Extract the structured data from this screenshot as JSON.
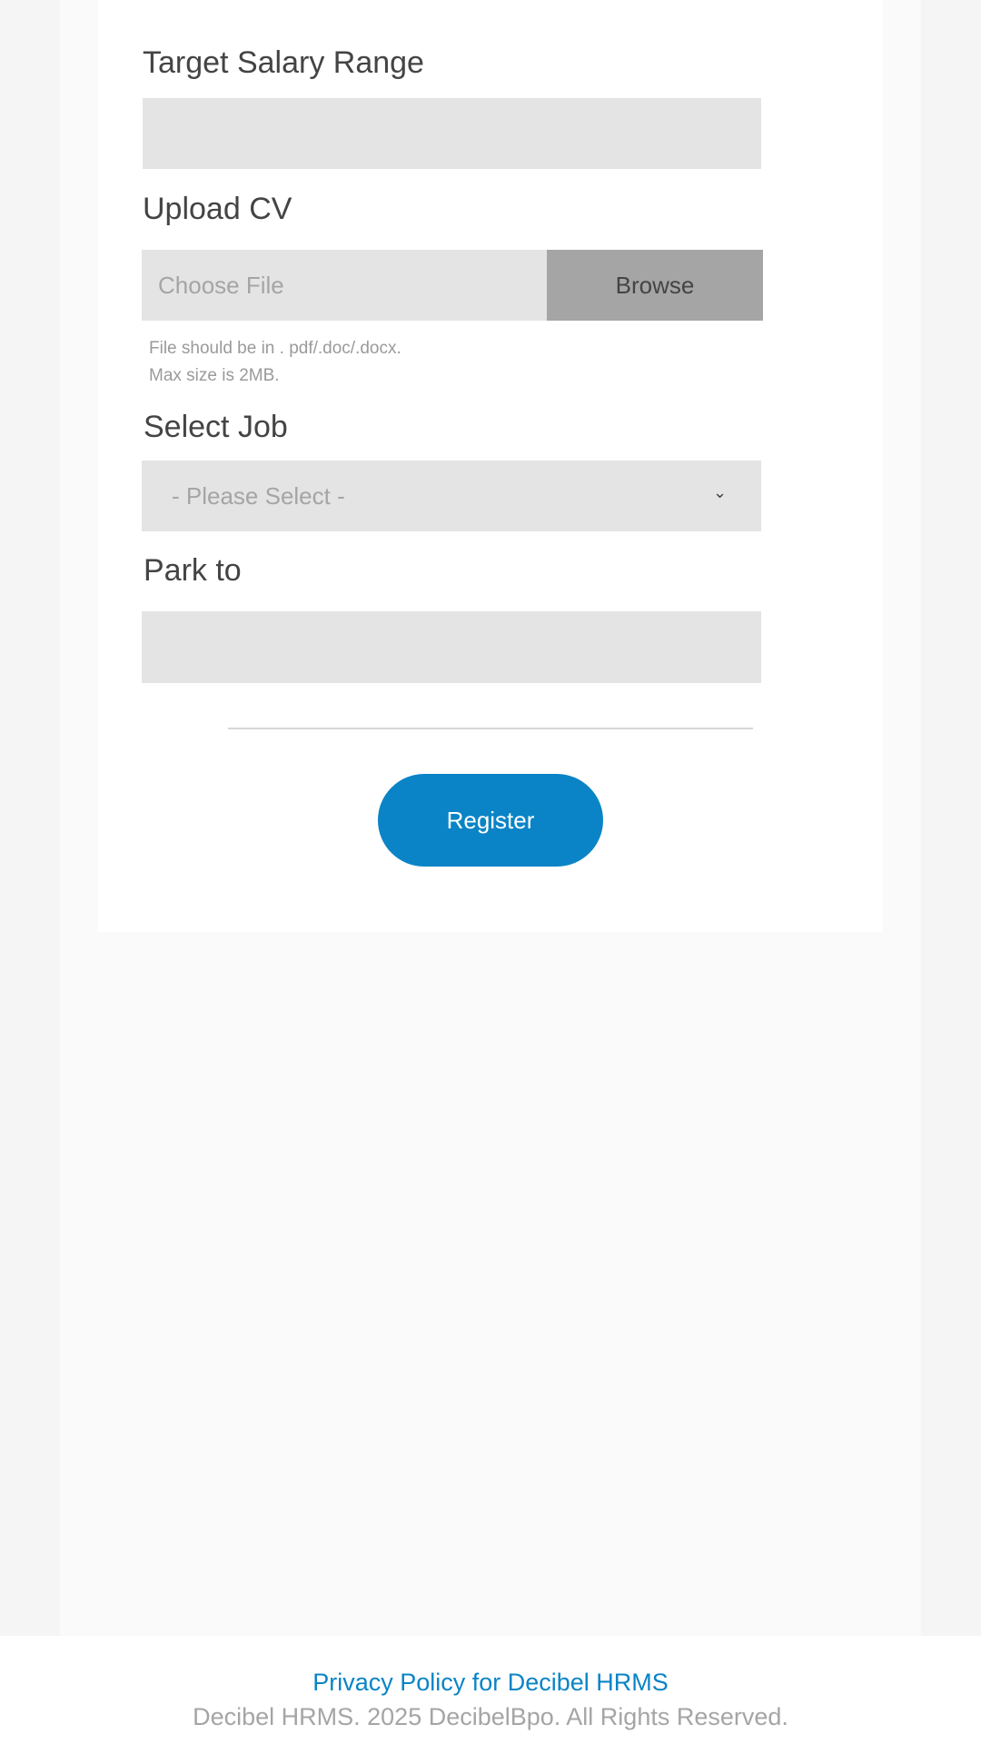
{
  "form": {
    "salary_label": "Target Salary Range",
    "salary_value": "",
    "cv_label": "Upload CV",
    "cv_placeholder": "Choose File",
    "browse_label": "Browse",
    "cv_hint_1": "File should be in . pdf/.doc/.docx.",
    "cv_hint_2": "Max size is 2MB.",
    "job_label": "Select Job",
    "job_selected": "- Please Select -",
    "park_label": "Park to",
    "park_value": "",
    "register_label": "Register"
  },
  "footer": {
    "privacy_link": "Privacy Policy for Decibel HRMS",
    "copyright": "Decibel HRMS. 2025 DecibelBpo. All Rights Reserved."
  },
  "colors": {
    "accent": "#0a84c6",
    "input_bg": "#e4e4e4",
    "browse_bg": "#a5a5a5"
  }
}
